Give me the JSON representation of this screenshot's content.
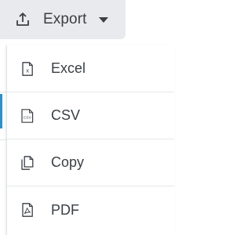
{
  "export_button": {
    "label": "Export",
    "icon": "upload-icon",
    "caret_icon": "caret-down-icon"
  },
  "menu": {
    "items": [
      {
        "label": "Excel",
        "icon": "excel-file-icon",
        "icon_text": "x"
      },
      {
        "label": "CSV",
        "icon": "csv-file-icon",
        "icon_text": "CSV"
      },
      {
        "label": "Copy",
        "icon": "copy-icon"
      },
      {
        "label": "PDF",
        "icon": "pdf-file-icon"
      }
    ]
  },
  "colors": {
    "text": "#3a3f44",
    "button_bg": "#e8eaed",
    "divider": "#e6e8ea",
    "accent": "#2f8fc7"
  }
}
